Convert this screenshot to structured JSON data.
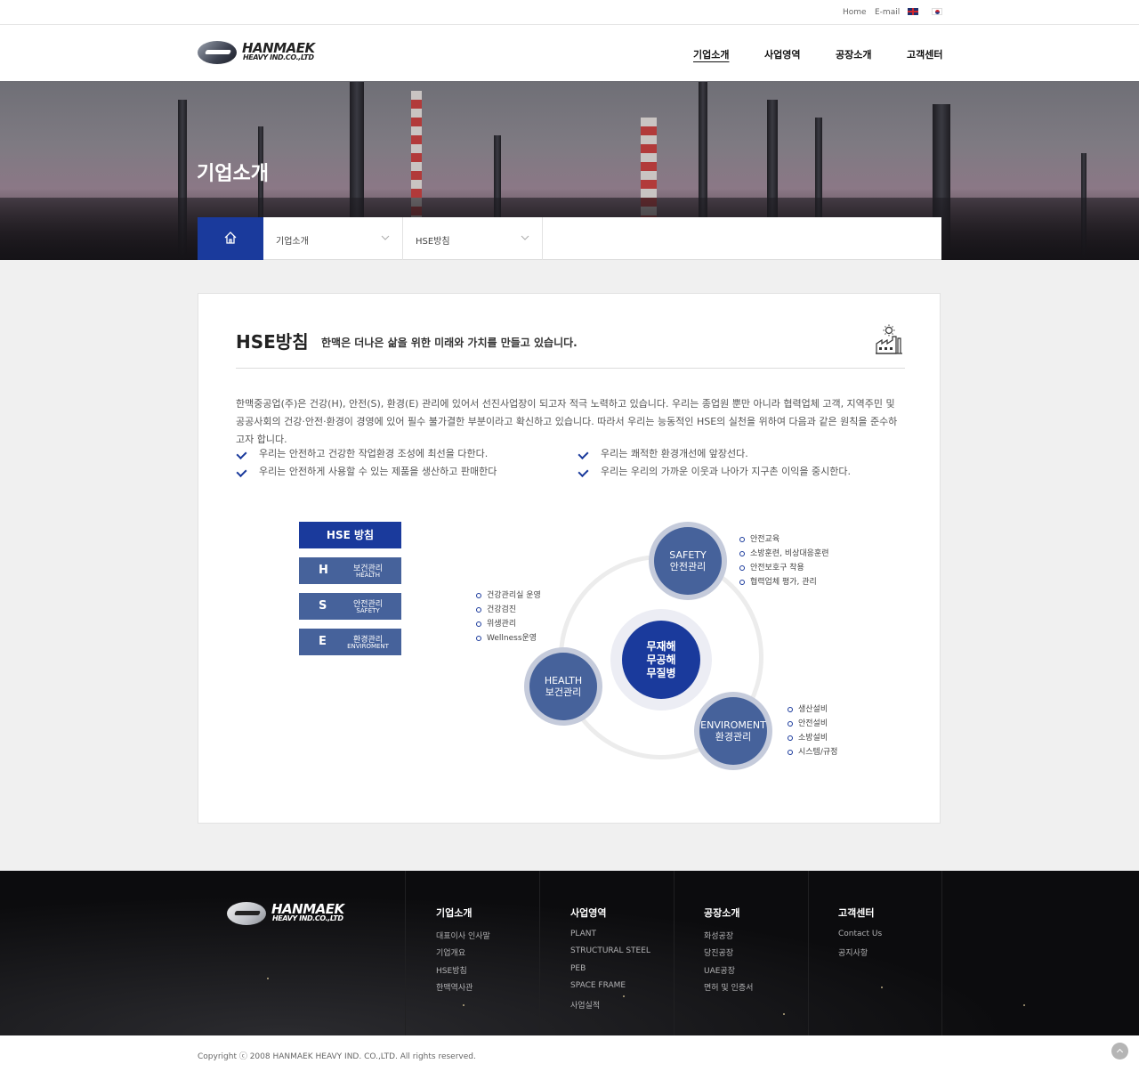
{
  "util": {
    "home": "Home",
    "email": "E-mail",
    "lang_en_icon": "uk-flag-icon",
    "lang_ko_icon": "korea-flag-icon"
  },
  "logo": {
    "name": "HANMAEK",
    "sub": "HEAVY IND.CO.,LTD"
  },
  "gnb": [
    "기업소개",
    "사업영역",
    "공장소개",
    "고객센터"
  ],
  "hero": {
    "title": "기업소개"
  },
  "breadcrumb": {
    "home_icon": "home-icon",
    "depth1": "기업소개",
    "depth2": "HSE방침"
  },
  "content": {
    "title": "HSE방침",
    "subtitle": "한맥은 더나은 삶을 위한 미래와 가치를 만들고 있습니다.",
    "title_icon": "factory-sun-icon",
    "intro": "한맥중공업(주)은 건강(H), 안전(S), 환경(E) 관리에 있어서 선진사업장이 되고자 적극 노력하고 있습니다. 우리는 종업원 뿐만 아니라 협력업체 고객, 지역주민 및 공공사회의 건강·안전·환경이 경영에 있어 필수 불가결한 부분이라고 확신하고 있습니다. 따라서 우리는 능동적인 HSE의 실천을 위하여 다음과 같은 원칙을 준수하고자 합니다.",
    "principles_left": [
      "우리는 안전하고 건강한 작업환경 조성에 최선을 다한다.",
      "우리는 안전하게 사용할 수 있는 제품을 생산하고 판매한다"
    ],
    "principles_right": [
      "우리는 쾌적한 환경개선에 앞장선다.",
      "우리는 우리의 가까운 이웃과 나아가 지구촌 이익을 중시한다."
    ]
  },
  "hse_menu": {
    "head": "HSE 방침",
    "items": [
      {
        "letter": "H",
        "ko": "보건관리",
        "en": "HEALTH"
      },
      {
        "letter": "S",
        "ko": "안전관리",
        "en": "SAFETY"
      },
      {
        "letter": "E",
        "ko": "환경관리",
        "en": "ENVIROMENT"
      }
    ]
  },
  "diagram": {
    "center": [
      "무재해",
      "무공해",
      "무질병"
    ],
    "safety": {
      "en": "SAFETY",
      "ko": "안전관리",
      "items": [
        "안전교육",
        "소방훈련, 비상대응훈련",
        "안전보호구 착용",
        "협력업체 평가, 관리"
      ]
    },
    "health": {
      "en": "HEALTH",
      "ko": "보건관리",
      "items": [
        "건강관리실 운영",
        "건강검진",
        "위생관리",
        "Wellness운영"
      ]
    },
    "enviroment": {
      "en": "ENVIROMENT",
      "ko": "환경관리",
      "items": [
        "생산설비",
        "안전설비",
        "소방설비",
        "시스템/규정"
      ]
    },
    "colors": {
      "primary": "#1a3a9c",
      "node": "#46629b",
      "halo": "#c5cbdb"
    }
  },
  "footer": {
    "columns": [
      {
        "head": "기업소개",
        "links": [
          "대표이사 인사말",
          "기업개요",
          "HSE방침",
          "한맥역사관"
        ]
      },
      {
        "head": "사업영역",
        "links": [
          "PLANT",
          "STRUCTURAL STEEL",
          "PEB",
          "SPACE FRAME",
          "사업실적"
        ]
      },
      {
        "head": "공장소개",
        "links": [
          "화성공장",
          "당진공장",
          "UAE공장",
          "면허 및 인증서"
        ]
      },
      {
        "head": "고객센터",
        "links": [
          "Contact Us",
          "공지사항"
        ]
      }
    ],
    "copyright": "Copyright ⓒ 2008 HANMAEK HEAVY IND. CO.,LTD. All rights reserved.",
    "to_top_icon": "arrow-up-icon"
  }
}
